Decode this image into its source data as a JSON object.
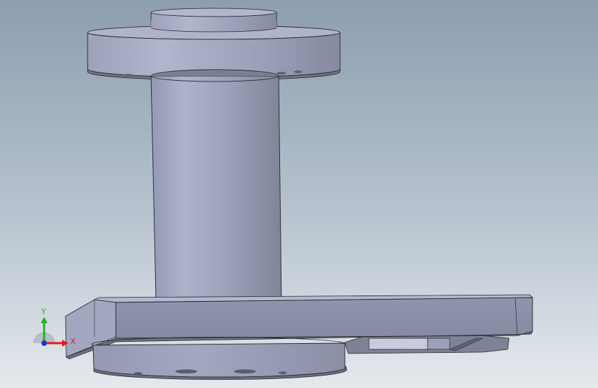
{
  "viewport": {
    "background_top": "#8e9fb0",
    "background_bottom": "#dfe5ea",
    "model_fill_light": "#a9aec8",
    "model_fill_mid": "#9a9fb9",
    "model_fill_dark": "#7e8399",
    "edge_color": "#1a1a1a"
  },
  "triad": {
    "x_label": "X",
    "y_label": "Y",
    "x_color": "#e3171c",
    "y_color": "#1eb31e",
    "z_color": "#1f2fd6"
  }
}
